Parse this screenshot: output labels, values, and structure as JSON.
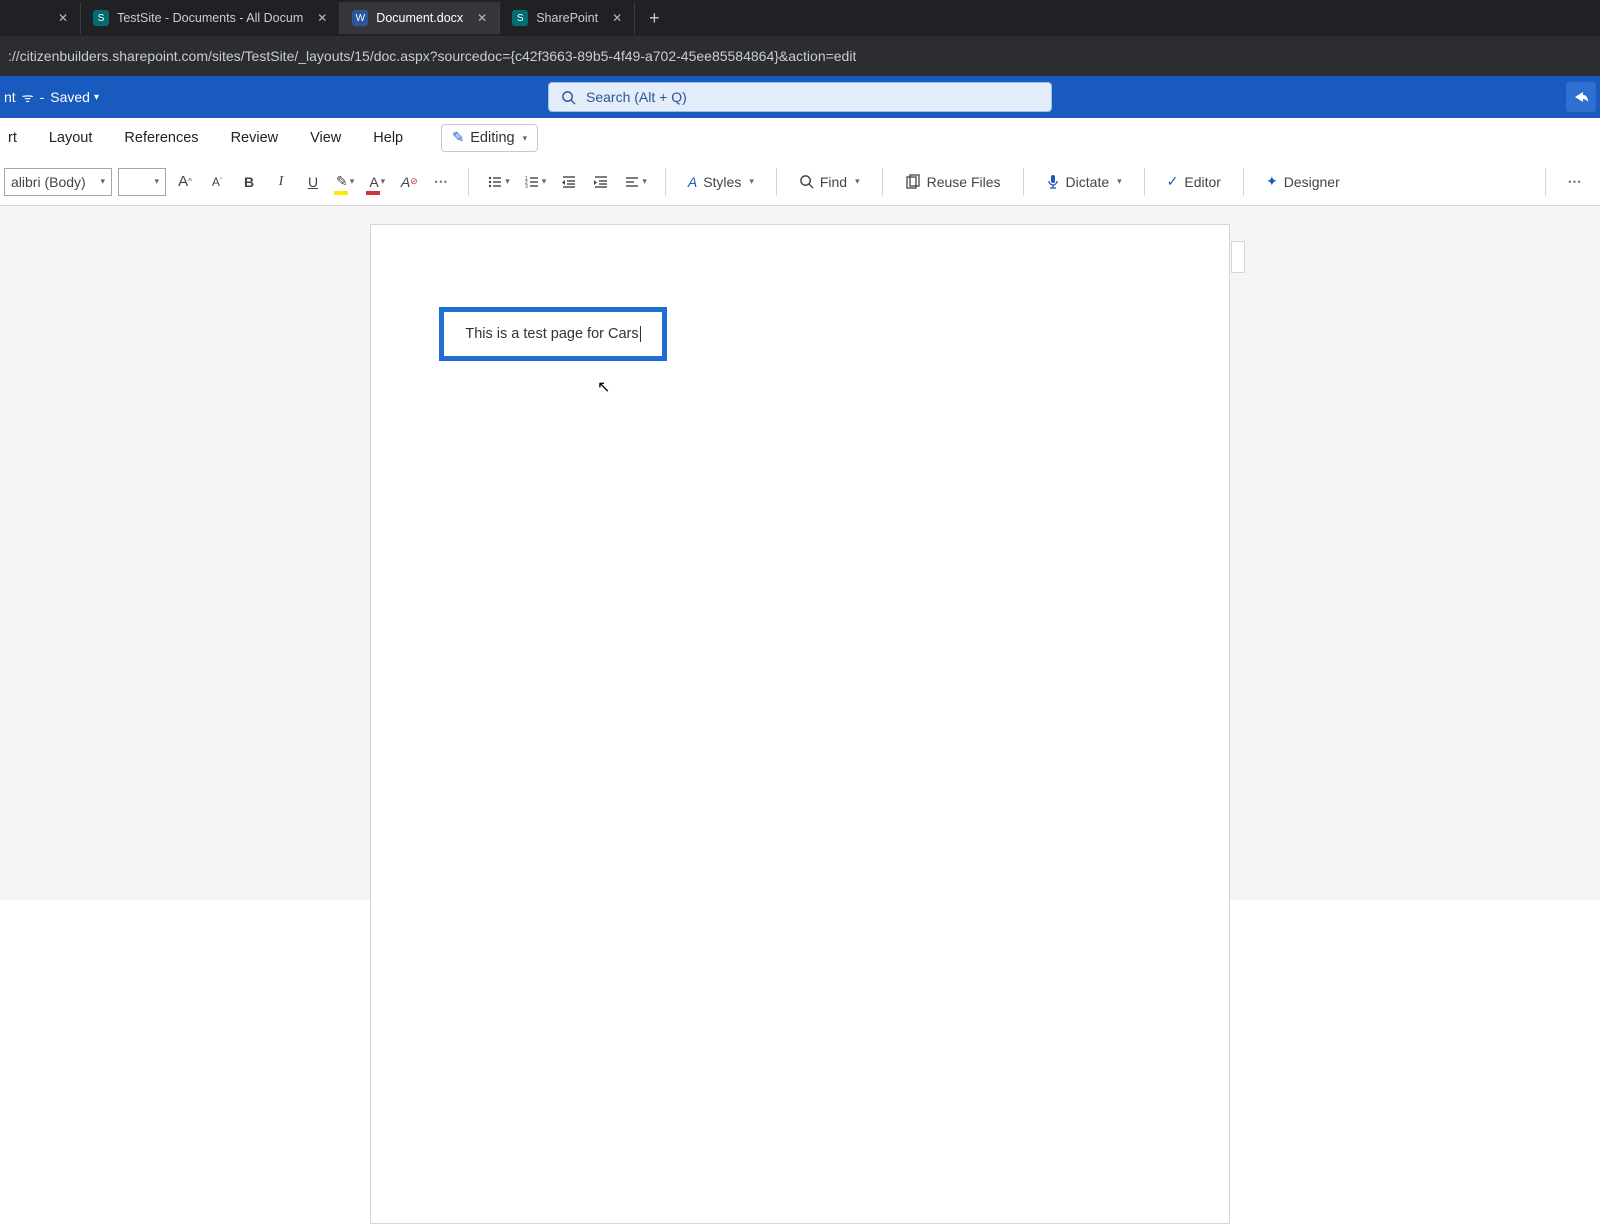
{
  "browser": {
    "tabs": [
      {
        "title": "TestSite - Documents - All Docum",
        "fav": "S",
        "favclass": "fav-sp"
      },
      {
        "title": "Document.docx",
        "fav": "W",
        "favclass": "fav-wd"
      },
      {
        "title": "SharePoint",
        "fav": "S",
        "favclass": "fav-sp"
      }
    ],
    "active_index": 1,
    "url": "://citizenbuilders.sharepoint.com/sites/TestSite/_layouts/15/doc.aspx?sourcedoc={c42f3663-89b5-4f49-a702-45ee85584864}&action=edit"
  },
  "header": {
    "doc_fragment": "nt",
    "saved_label": "Saved",
    "search_placeholder": "Search (Alt + Q)"
  },
  "ribbon_tabs": {
    "items": [
      "rt",
      "Layout",
      "References",
      "Review",
      "View",
      "Help"
    ],
    "editing_label": "Editing"
  },
  "ribbon": {
    "font_name": "alibri (Body)",
    "font_size": "",
    "styles_label": "Styles",
    "find_label": "Find",
    "reuse_label": "Reuse Files",
    "dictate_label": "Dictate",
    "editor_label": "Editor",
    "designer_label": "Designer"
  },
  "document": {
    "textbox_content": "This is a test page for Cars"
  }
}
